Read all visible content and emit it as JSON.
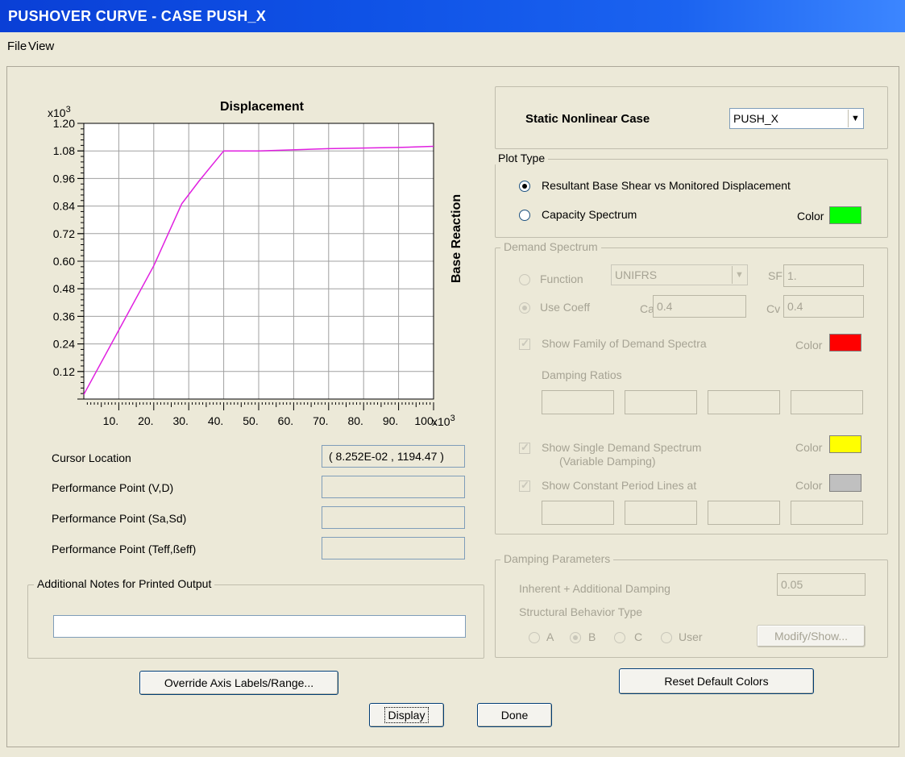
{
  "window": {
    "title": "PUSHOVER CURVE - CASE PUSH_X"
  },
  "menu": {
    "file": "File",
    "view": "View"
  },
  "chart_data": {
    "type": "line",
    "title": "Displacement",
    "ylabel": "Base Reaction",
    "x_multiplier": "x10",
    "y_multiplier": "x10",
    "multiplier_exponent": "3",
    "x_ticks": [
      "10.",
      "20.",
      "30.",
      "40.",
      "50.",
      "60.",
      "70.",
      "80.",
      "90.",
      "100."
    ],
    "y_ticks": [
      "0.12",
      "0.24",
      "0.36",
      "0.48",
      "0.60",
      "0.72",
      "0.84",
      "0.96",
      "1.08",
      "1.20"
    ],
    "xlim": [
      0,
      100
    ],
    "ylim": [
      0,
      1.2
    ],
    "grid": true,
    "series": [
      {
        "color": "#e020e0",
        "x": [
          0,
          10,
          20,
          28,
          33,
          40,
          50,
          70,
          90,
          100
        ],
        "y": [
          0.02,
          0.3,
          0.58,
          0.85,
          0.95,
          1.08,
          1.08,
          1.09,
          1.095,
          1.1
        ]
      }
    ]
  },
  "info": {
    "cursor_label": "Cursor Location",
    "cursor_value": "( 8.252E-02 , 1194.47 )",
    "pp_vd_label": "Performance Point (V,D)",
    "pp_sasd_label": "Performance Point (Sa,Sd)",
    "pp_teff_label": "Performance Point (Teff,ßeff)"
  },
  "notes": {
    "title": "Additional Notes for Printed Output",
    "value": ""
  },
  "case": {
    "label": "Static Nonlinear Case",
    "selected": "PUSH_X"
  },
  "plot_type": {
    "title": "Plot Type",
    "option1": "Resultant Base Shear vs Monitored Displacement",
    "option2": "Capacity Spectrum",
    "color_label": "Color",
    "color": "#00ff00",
    "selected": "option1"
  },
  "demand": {
    "title": "Demand Spectrum",
    "function_label": "Function",
    "function_value": "UNIFRS",
    "sf_label": "SF",
    "sf_value": "1.",
    "use_coeff_label": "Use Coeff",
    "ca_label": "Ca",
    "ca_value": "0.4",
    "cv_label": "Cv",
    "cv_value": "0.4",
    "family_label": "Show Family of Demand Spectra",
    "family_color_label": "Color",
    "family_color": "#ff0000",
    "damping_ratios_label": "Damping Ratios",
    "single_label": "Show Single  Demand Spectrum",
    "single_sublabel": "(Variable Damping)",
    "single_color_label": "Color",
    "single_color": "#ffff00",
    "period_label": "Show Constant Period Lines at",
    "period_color_label": "Color",
    "period_color": "#c0c0c0"
  },
  "damping": {
    "title": "Damping Parameters",
    "inherent_label": "Inherent + Additional Damping",
    "inherent_value": "0.05",
    "behavior_label": "Structural Behavior Type",
    "opt_a": "A",
    "opt_b": "B",
    "opt_c": "C",
    "opt_user": "User",
    "modify_button": "Modify/Show..."
  },
  "buttons": {
    "override": "Override Axis Labels/Range...",
    "reset": "Reset Default Colors",
    "display": "Display",
    "done": "Done"
  }
}
